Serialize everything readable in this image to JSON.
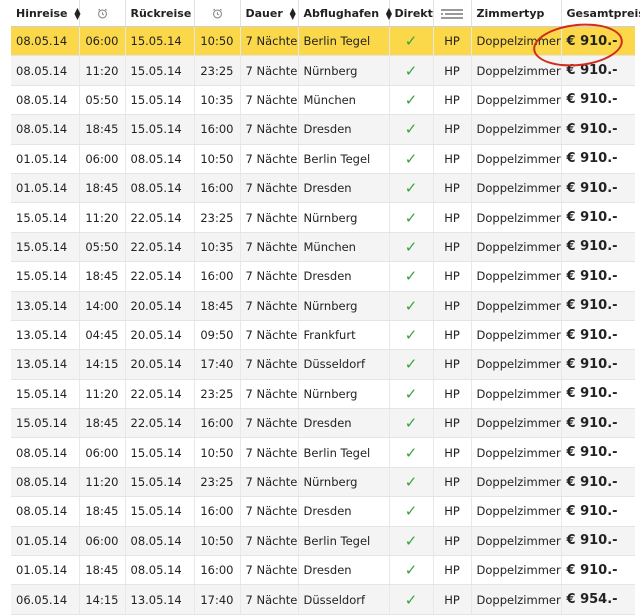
{
  "headers": {
    "departure": "Hinreise",
    "return": "Rückreise",
    "duration": "Dauer",
    "airport": "Abflughafen",
    "direct": "Direkt",
    "room": "Zimmertyp",
    "total": "Gesamtpreis"
  },
  "icons": {
    "sort": "sort-arrows-icon",
    "sort_desc": "sort-desc-icon",
    "clock": "alarm-clock-icon",
    "meal": "cutlery-icon",
    "check": "checkmark-icon"
  },
  "colors": {
    "selected_row": "#fbd84a",
    "check": "#3da23a",
    "highlight_circle": "#d32a1c"
  },
  "rows": [
    {
      "dep_date": "08.05.14",
      "dep_time": "06:00",
      "ret_date": "15.05.14",
      "ret_time": "10:50",
      "duration": "7 Nächte",
      "airport": "Berlin Tegel",
      "direct": "✓",
      "meal": "HP",
      "room": "Doppelzimmer",
      "price": "€ 910.-",
      "selected": true
    },
    {
      "dep_date": "08.05.14",
      "dep_time": "11:20",
      "ret_date": "15.05.14",
      "ret_time": "23:25",
      "duration": "7 Nächte",
      "airport": "Nürnberg",
      "direct": "✓",
      "meal": "HP",
      "room": "Doppelzimmer",
      "price": "€ 910.-"
    },
    {
      "dep_date": "08.05.14",
      "dep_time": "05:50",
      "ret_date": "15.05.14",
      "ret_time": "10:35",
      "duration": "7 Nächte",
      "airport": "München",
      "direct": "✓",
      "meal": "HP",
      "room": "Doppelzimmer",
      "price": "€ 910.-"
    },
    {
      "dep_date": "08.05.14",
      "dep_time": "18:45",
      "ret_date": "15.05.14",
      "ret_time": "16:00",
      "duration": "7 Nächte",
      "airport": "Dresden",
      "direct": "✓",
      "meal": "HP",
      "room": "Doppelzimmer",
      "price": "€ 910.-"
    },
    {
      "dep_date": "01.05.14",
      "dep_time": "06:00",
      "ret_date": "08.05.14",
      "ret_time": "10:50",
      "duration": "7 Nächte",
      "airport": "Berlin Tegel",
      "direct": "✓",
      "meal": "HP",
      "room": "Doppelzimmer",
      "price": "€ 910.-"
    },
    {
      "dep_date": "01.05.14",
      "dep_time": "18:45",
      "ret_date": "08.05.14",
      "ret_time": "16:00",
      "duration": "7 Nächte",
      "airport": "Dresden",
      "direct": "✓",
      "meal": "HP",
      "room": "Doppelzimmer",
      "price": "€ 910.-"
    },
    {
      "dep_date": "15.05.14",
      "dep_time": "11:20",
      "ret_date": "22.05.14",
      "ret_time": "23:25",
      "duration": "7 Nächte",
      "airport": "Nürnberg",
      "direct": "✓",
      "meal": "HP",
      "room": "Doppelzimmer",
      "price": "€ 910.-"
    },
    {
      "dep_date": "15.05.14",
      "dep_time": "05:50",
      "ret_date": "22.05.14",
      "ret_time": "10:35",
      "duration": "7 Nächte",
      "airport": "München",
      "direct": "✓",
      "meal": "HP",
      "room": "Doppelzimmer",
      "price": "€ 910.-"
    },
    {
      "dep_date": "15.05.14",
      "dep_time": "18:45",
      "ret_date": "22.05.14",
      "ret_time": "16:00",
      "duration": "7 Nächte",
      "airport": "Dresden",
      "direct": "✓",
      "meal": "HP",
      "room": "Doppelzimmer",
      "price": "€ 910.-"
    },
    {
      "dep_date": "13.05.14",
      "dep_time": "14:00",
      "ret_date": "20.05.14",
      "ret_time": "18:45",
      "duration": "7 Nächte",
      "airport": "Nürnberg",
      "direct": "✓",
      "meal": "HP",
      "room": "Doppelzimmer",
      "price": "€ 910.-"
    },
    {
      "dep_date": "13.05.14",
      "dep_time": "04:45",
      "ret_date": "20.05.14",
      "ret_time": "09:50",
      "duration": "7 Nächte",
      "airport": "Frankfurt",
      "direct": "✓",
      "meal": "HP",
      "room": "Doppelzimmer",
      "price": "€ 910.-"
    },
    {
      "dep_date": "13.05.14",
      "dep_time": "14:15",
      "ret_date": "20.05.14",
      "ret_time": "17:40",
      "duration": "7 Nächte",
      "airport": "Düsseldorf",
      "direct": "✓",
      "meal": "HP",
      "room": "Doppelzimmer",
      "price": "€ 910.-"
    },
    {
      "dep_date": "15.05.14",
      "dep_time": "11:20",
      "ret_date": "22.05.14",
      "ret_time": "23:25",
      "duration": "7 Nächte",
      "airport": "Nürnberg",
      "direct": "✓",
      "meal": "HP",
      "room": "Doppelzimmer",
      "price": "€ 910.-"
    },
    {
      "dep_date": "15.05.14",
      "dep_time": "18:45",
      "ret_date": "22.05.14",
      "ret_time": "16:00",
      "duration": "7 Nächte",
      "airport": "Dresden",
      "direct": "✓",
      "meal": "HP",
      "room": "Doppelzimmer",
      "price": "€ 910.-"
    },
    {
      "dep_date": "08.05.14",
      "dep_time": "06:00",
      "ret_date": "15.05.14",
      "ret_time": "10:50",
      "duration": "7 Nächte",
      "airport": "Berlin Tegel",
      "direct": "✓",
      "meal": "HP",
      "room": "Doppelzimmer",
      "price": "€ 910.-"
    },
    {
      "dep_date": "08.05.14",
      "dep_time": "11:20",
      "ret_date": "15.05.14",
      "ret_time": "23:25",
      "duration": "7 Nächte",
      "airport": "Nürnberg",
      "direct": "✓",
      "meal": "HP",
      "room": "Doppelzimmer",
      "price": "€ 910.-"
    },
    {
      "dep_date": "08.05.14",
      "dep_time": "18:45",
      "ret_date": "15.05.14",
      "ret_time": "16:00",
      "duration": "7 Nächte",
      "airport": "Dresden",
      "direct": "✓",
      "meal": "HP",
      "room": "Doppelzimmer",
      "price": "€ 910.-"
    },
    {
      "dep_date": "01.05.14",
      "dep_time": "06:00",
      "ret_date": "08.05.14",
      "ret_time": "10:50",
      "duration": "7 Nächte",
      "airport": "Berlin Tegel",
      "direct": "✓",
      "meal": "HP",
      "room": "Doppelzimmer",
      "price": "€ 910.-"
    },
    {
      "dep_date": "01.05.14",
      "dep_time": "18:45",
      "ret_date": "08.05.14",
      "ret_time": "16:00",
      "duration": "7 Nächte",
      "airport": "Dresden",
      "direct": "✓",
      "meal": "HP",
      "room": "Doppelzimmer",
      "price": "€ 910.-"
    },
    {
      "dep_date": "06.05.14",
      "dep_time": "14:15",
      "ret_date": "13.05.14",
      "ret_time": "17:40",
      "duration": "7 Nächte",
      "airport": "Düsseldorf",
      "direct": "✓",
      "meal": "HP",
      "room": "Doppelzimmer",
      "price": "€ 954.-"
    }
  ]
}
